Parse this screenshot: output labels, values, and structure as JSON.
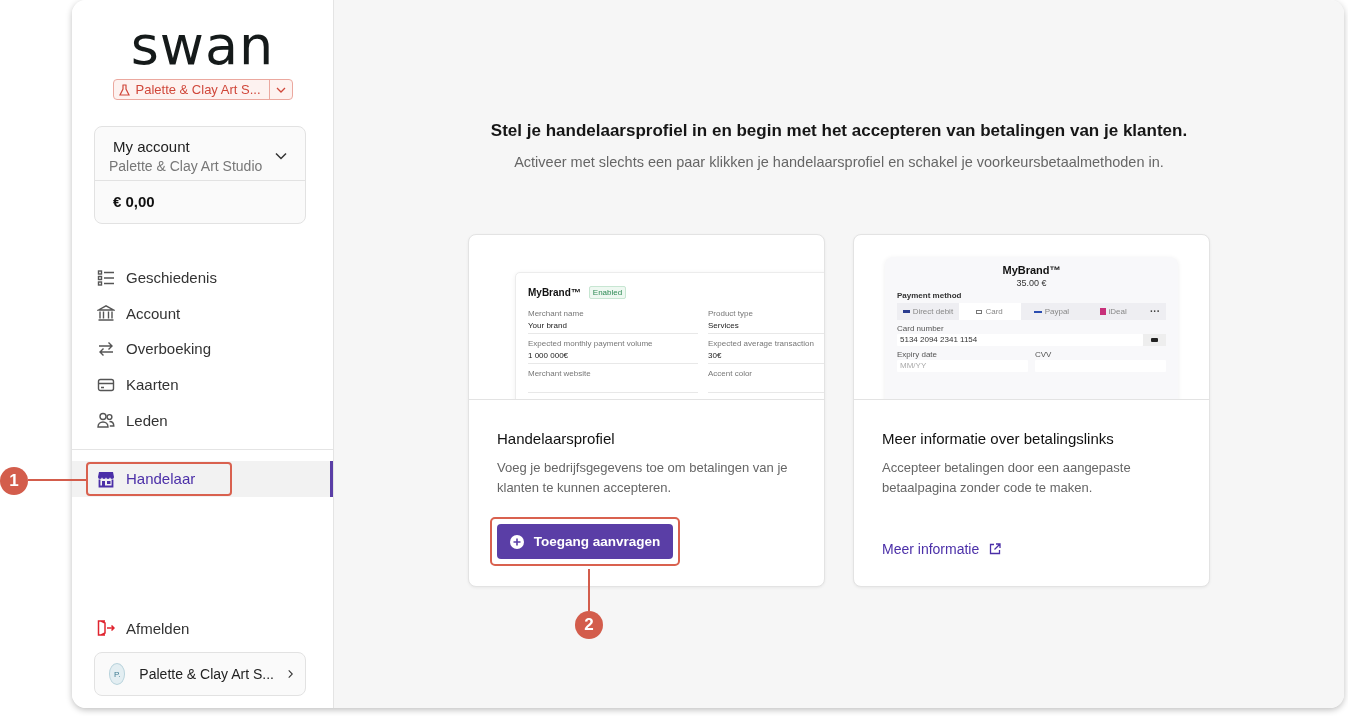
{
  "logo": {
    "text": "swan"
  },
  "project_switcher": {
    "label": "Palette & Clay Art S..."
  },
  "account": {
    "title": "My account",
    "subtitle": "Palette & Clay Art Studio",
    "balance": "€ 0,00"
  },
  "nav": [
    {
      "label": "Geschiedenis",
      "selected": false,
      "highlighted": false
    },
    {
      "label": "Account",
      "selected": false,
      "highlighted": false
    },
    {
      "label": "Overboeking",
      "selected": false,
      "highlighted": false
    },
    {
      "label": "Kaarten",
      "selected": false,
      "highlighted": false
    },
    {
      "label": "Leden",
      "selected": false,
      "highlighted": false
    }
  ],
  "nav_bottom": [
    {
      "label": "Handelaar",
      "selected": true,
      "highlighted": true
    }
  ],
  "logout": {
    "label": "Afmelden"
  },
  "user": {
    "initial": "P.",
    "name": "Palette & Clay Art S..."
  },
  "heading": "Stel je handelaarsprofiel in en begin met het accepteren van betalingen van je klanten.",
  "subheading": "Activeer met slechts een paar klikken je handelaarsprofiel en schakel je voorkeursbetaalmethoden in.",
  "cards": [
    {
      "kind": "merchant_profile",
      "preview": {
        "brand": "MyBrand™",
        "badge": "Enabled",
        "fields": [
          {
            "label": "Merchant name",
            "value": "Your brand"
          },
          {
            "label": "Product type",
            "value": "Services"
          },
          {
            "label": "Expected monthly payment volume",
            "value": "1 000 000€"
          },
          {
            "label": "Expected average transaction",
            "value": "30€"
          },
          {
            "label": "Merchant website"
          },
          {
            "label": "Accent color"
          }
        ]
      },
      "title": "Handelaarsprofiel",
      "text": "Voeg je bedrijfsgegevens toe om betalingen van je klanten te kunnen accepteren.",
      "button": {
        "label": "Toegang aanvragen",
        "highlighted": true
      }
    },
    {
      "kind": "payment_links",
      "preview": {
        "brand": "MyBrand™",
        "amount": "35.00 €",
        "method_label": "Payment method",
        "methods": [
          {
            "label": "Direct debit",
            "selected": false
          },
          {
            "label": "Card",
            "selected": true
          },
          {
            "label": "Paypal",
            "selected": false
          },
          {
            "label": "iDeal",
            "selected": false
          }
        ],
        "more": "···",
        "card_number_label": "Card number",
        "card_number": "5134 2094 2341 1154",
        "expiry_label": "Expiry date",
        "expiry_placeholder": "MM/YY",
        "cvv_label": "CVV"
      },
      "title": "Meer informatie over betalingslinks",
      "text": "Accepteer betalingen door een aangepaste betaalpagina zonder code te maken.",
      "link": {
        "label": "Meer informatie"
      }
    }
  ],
  "annotations": [
    {
      "label": "1"
    },
    {
      "label": "2"
    }
  ]
}
